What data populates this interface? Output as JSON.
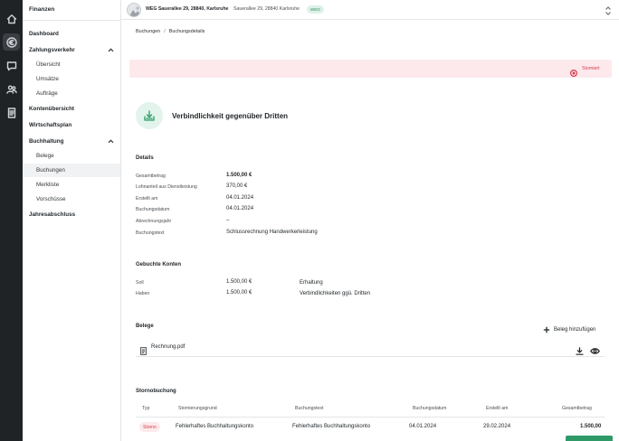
{
  "sidebar": {
    "title": "Finanzen",
    "items": [
      {
        "label": "Dashboard"
      },
      {
        "label": "Zahlungsverkehr"
      },
      {
        "label": "Übersicht"
      },
      {
        "label": "Umsätze"
      },
      {
        "label": "Aufträge"
      },
      {
        "label": "Kontenübersicht"
      },
      {
        "label": "Wirtschaftsplan"
      },
      {
        "label": "Buchhaltung"
      },
      {
        "label": "Belege"
      },
      {
        "label": "Buchungen"
      },
      {
        "label": "Merkliste"
      },
      {
        "label": "Vorschüsse"
      },
      {
        "label": "Jahresabschluss"
      }
    ]
  },
  "header": {
    "property": "WEG Sauerallee 29, 28840, Karlsruhe",
    "address": "Sauerallee 29, 28840 Karlsruhe",
    "badge": "WEG"
  },
  "breadcrumb": {
    "parent": "Buchungen",
    "separator": "/",
    "current": "Buchungsdetails"
  },
  "banner": {
    "status": "Storniert",
    "color": "#d9394b"
  },
  "booking": {
    "title": "Verbindlichkeit gegenüber Dritten"
  },
  "details": {
    "title": "Details",
    "rows": [
      {
        "label": "Gesamtbetrag",
        "value": "1.500,00 €"
      },
      {
        "label": "Lohnanteil aus Dienstleistung",
        "value": "370,00 €"
      },
      {
        "label": "Erstellt am",
        "value": "04.01.2024"
      },
      {
        "label": "Buchungsdatum",
        "value": "04.01.2024"
      },
      {
        "label": "Abrechnungsjahr",
        "value": "–"
      },
      {
        "label": "Buchungstext",
        "value": "Schlussrechnung Handwerkerleistung"
      }
    ]
  },
  "konten": {
    "title": "Gebuchte Konten",
    "rows": [
      {
        "label": "Soll",
        "amount": "1.500,00 €",
        "account": "Erhaltung"
      },
      {
        "label": "Haben",
        "amount": "1.500,00 €",
        "account": "Verbindlichkeiten ggü. Dritten"
      }
    ]
  },
  "belege": {
    "title": "Belege",
    "add_label": "Beleg hinzufügen",
    "files": [
      {
        "name": "Rechnung.pdf"
      }
    ]
  },
  "storno": {
    "title": "Stornobuchung",
    "columns": [
      "Typ",
      "Stornierungsgrund",
      "Buchungstext",
      "Buchungsdatum",
      "Erstellt am",
      "Gesamtbetrag"
    ],
    "row": {
      "typ": "Storno",
      "grund": "Fehlerhaftes Buchhaltungskonto",
      "text": "Fehlerhaftes Buchhaltungskonto",
      "datum": "04.01.2024",
      "erstellt": "29.02.2024",
      "betrag": "1.500,00"
    }
  },
  "colors": {
    "accent": "#2f9a68",
    "danger": "#d9394b",
    "rail": "#1f2326"
  }
}
